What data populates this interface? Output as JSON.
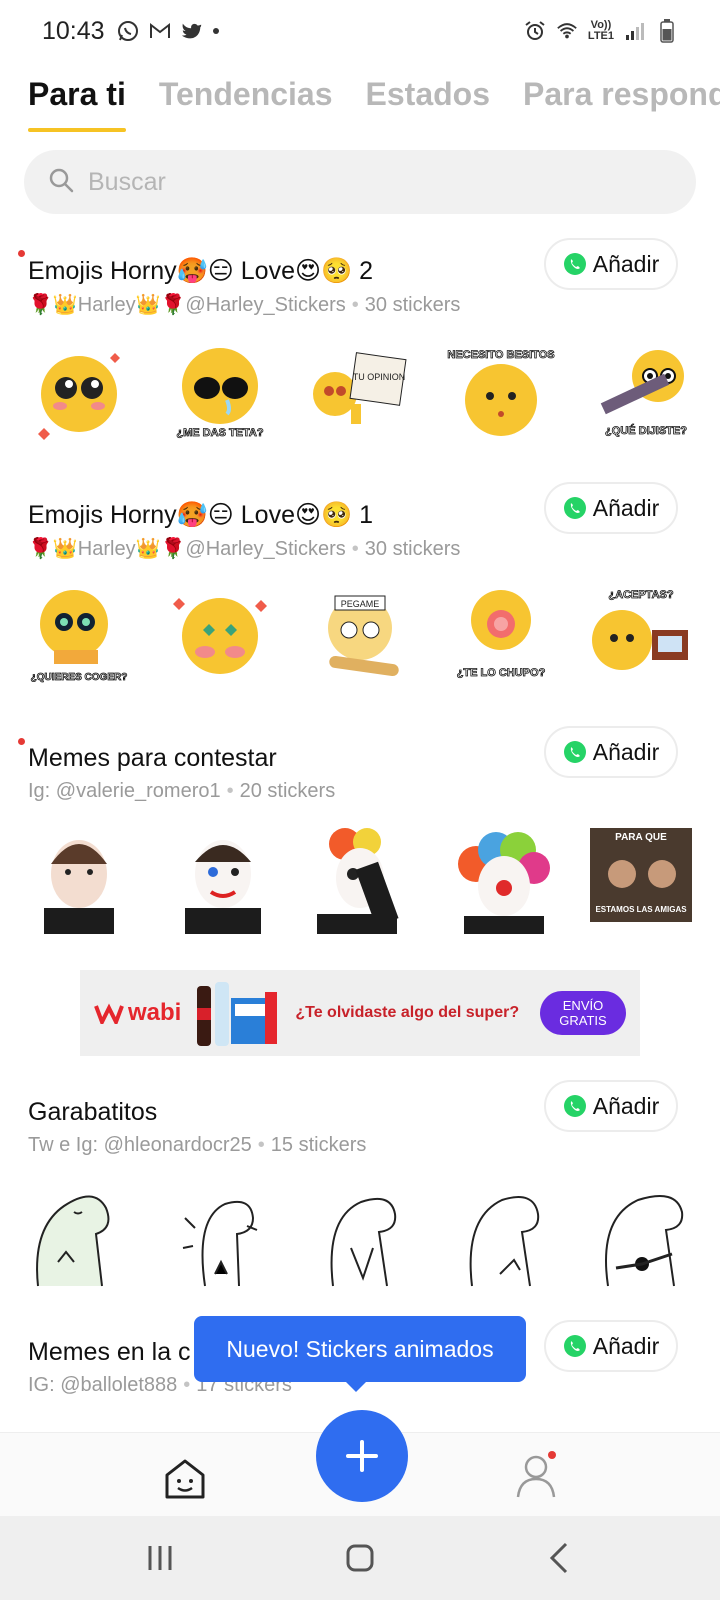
{
  "status_bar": {
    "time": "10:43",
    "left_icons": [
      "whatsapp-icon",
      "gmail-icon",
      "twitter-icon",
      "dot-icon"
    ],
    "right_icons": [
      "alarm-icon",
      "wifi-icon",
      "volte-icon",
      "signal-icon",
      "battery-icon"
    ],
    "volte_label_top": "Vo))",
    "volte_label_bottom": "LTE1"
  },
  "tabs": [
    {
      "label": "Para ti",
      "active": true
    },
    {
      "label": "Tendencias",
      "active": false
    },
    {
      "label": "Estados",
      "active": false
    },
    {
      "label": "Para respond",
      "active": false
    }
  ],
  "search": {
    "placeholder": "Buscar"
  },
  "add_label": "Añadir",
  "packs": [
    {
      "title": "Emojis Horny🥵😑 Love😍🥺 2",
      "author": "🌹👑Harley👑🌹@Harley_Stickers",
      "count": "30 stickers",
      "new": true
    },
    {
      "title": "Emojis Horny🥵😑 Love😍🥺 1",
      "author": "🌹👑Harley👑🌹@Harley_Stickers",
      "count": "30 stickers",
      "new": false
    },
    {
      "title": "Memes para contestar",
      "author": "Ig: @valerie_romero1",
      "count": "20 stickers",
      "new": true
    },
    {
      "title": "Garabatitos",
      "author": "Tw e Ig: @hleonardocr25",
      "count": "15 stickers",
      "new": false
    },
    {
      "title": "Memes en la c",
      "author": "IG: @ballolet888",
      "count": "17 stickers",
      "new": false
    }
  ],
  "sticker_captions": {
    "p1": [
      "",
      "¿ME DAS TETA?",
      "TU OPINION",
      "NECESITO BESITOS",
      "¿QUÉ DIJISTE?"
    ],
    "p2": [
      "¿QUIERES COGER?",
      "",
      "PEGAME",
      "¿TE LO CHUPO?",
      "¿ACEPTAS?"
    ],
    "p3_last_top": "PARA QUE",
    "p3_last_bottom": "ESTAMOS LAS AMIGAS"
  },
  "ad": {
    "brand": "wabi",
    "message": "¿Te olvidaste algo del super?",
    "cta_line1": "ENVÍO",
    "cta_line2": "GRATIS",
    "cta_color": "#6a2ce0"
  },
  "tooltip": "Nuevo! Stickers animados",
  "colors": {
    "accent": "#f6c324",
    "primary_blue": "#2f6df0",
    "whatsapp_green": "#25d366",
    "emoji_yellow": "#f7c531"
  }
}
